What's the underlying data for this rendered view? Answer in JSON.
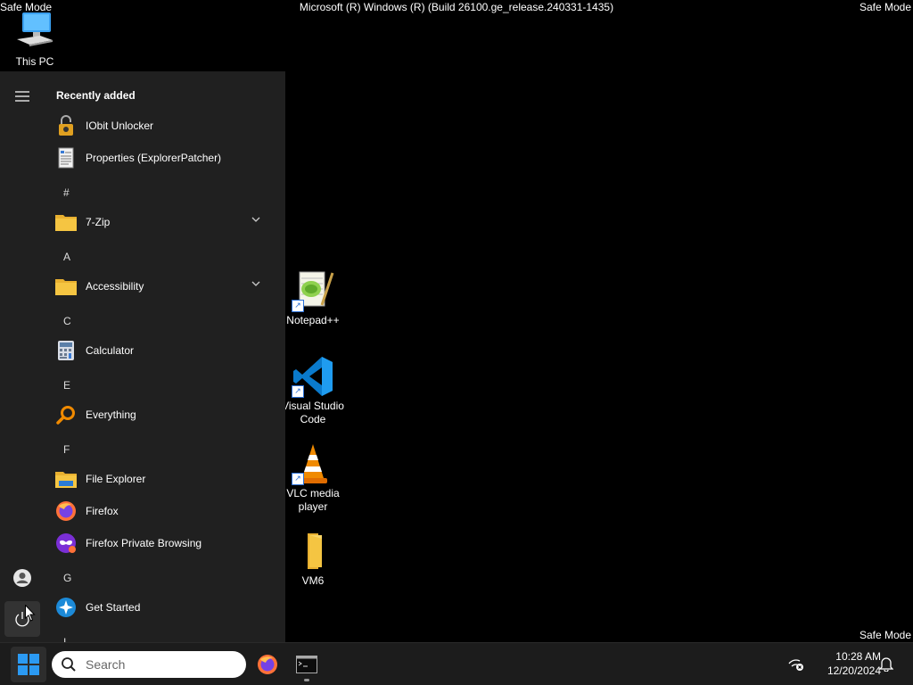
{
  "overlay": {
    "safe_mode": "Safe Mode",
    "build": "Microsoft (R) Windows (R) (Build 26100.ge_release.240331-1435)"
  },
  "desktop": {
    "this_pc": "This PC",
    "notepad": "Notepad++",
    "vscode": "Visual Studio Code",
    "vlc": "VLC media player",
    "vm6": "VM6"
  },
  "start_menu": {
    "recently_added": "Recently added",
    "recent": [
      "IObit Unlocker",
      "Properties (ExplorerPatcher)"
    ],
    "letters": [
      "#",
      "A",
      "C",
      "E",
      "F",
      "G",
      "I"
    ],
    "apps": {
      "zip": "7-Zip",
      "accessibility": "Accessibility",
      "calculator": "Calculator",
      "everything": "Everything",
      "file_explorer": "File Explorer",
      "firefox": "Firefox",
      "firefox_private": "Firefox Private Browsing",
      "get_started": "Get Started"
    }
  },
  "taskbar": {
    "search_placeholder": "Search",
    "time": "10:28 AM",
    "date": "12/20/2024"
  },
  "colors": {
    "start_bg": "#202020",
    "taskbar_bg": "#1c1c1c",
    "windows_blue": "#0078d4",
    "folder_yellow": "#f5c542"
  }
}
